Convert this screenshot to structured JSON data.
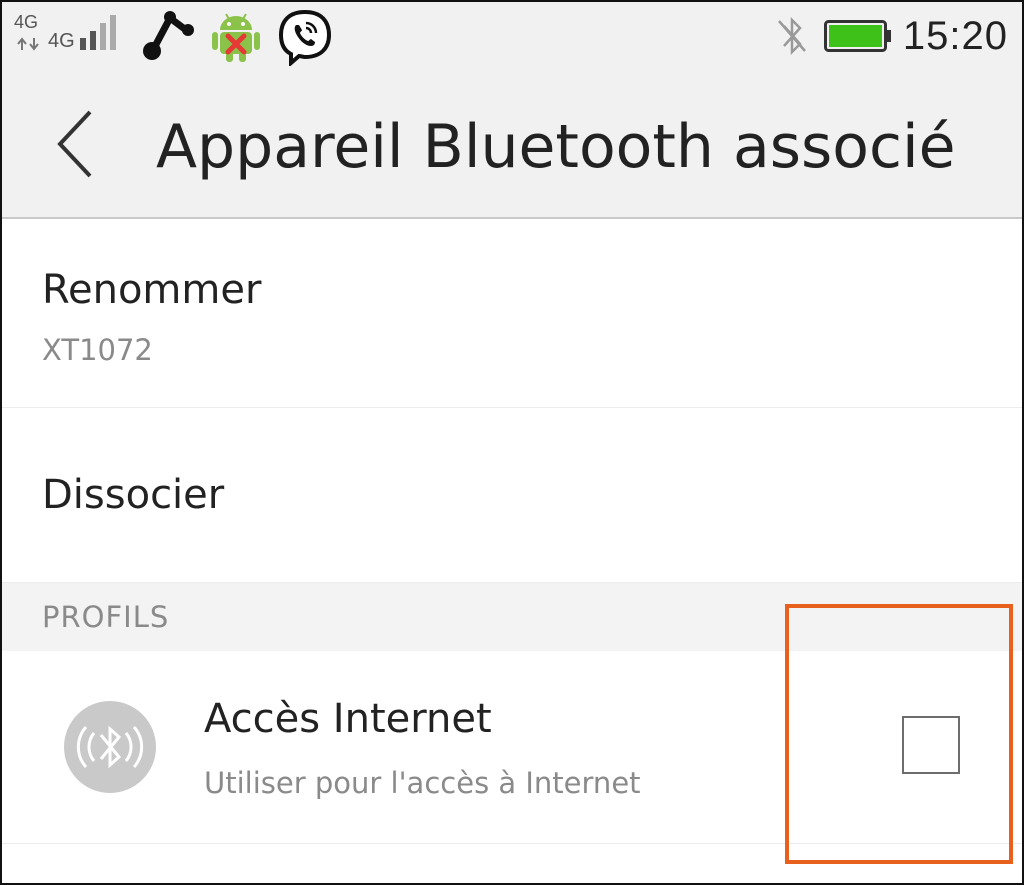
{
  "status_bar": {
    "network_top": "4G",
    "network_main": "4G",
    "time": "15:20",
    "icons": [
      "network-arrows-icon",
      "signal-bars-icon",
      "share-icon",
      "android-blocked-icon",
      "viber-icon",
      "bluetooth-off-icon",
      "battery-icon"
    ],
    "battery_level": 1.0,
    "colors": {
      "battery": "#3ec21a",
      "android": "#8bc34a",
      "blocked_x": "#e53935"
    }
  },
  "app_bar": {
    "title": "Appareil Bluetooth associé",
    "back_icon": "chevron-left-icon"
  },
  "items": [
    {
      "title": "Renommer",
      "subtitle": "XT1072"
    },
    {
      "title": "Dissocier"
    }
  ],
  "profiles": {
    "header": "PROFILS",
    "items": [
      {
        "title": "Accès Internet",
        "subtitle": "Utiliser pour l'accès à Internet",
        "icon": "bluetooth-audio-icon",
        "checked": false
      }
    ]
  },
  "annotation": {
    "highlight_color": "#e8601e"
  }
}
